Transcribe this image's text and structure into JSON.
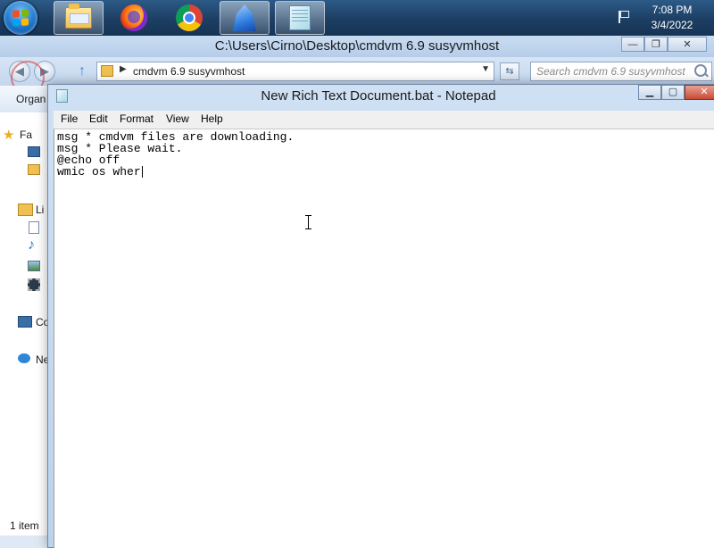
{
  "taskbar": {
    "apps": [
      {
        "name": "start",
        "icon": "windows-logo-icon"
      },
      {
        "name": "explorer",
        "icon": "folder-icon"
      },
      {
        "name": "firefox",
        "icon": "firefox-icon"
      },
      {
        "name": "chrome",
        "icon": "chrome-icon"
      },
      {
        "name": "app",
        "icon": "app-icon"
      },
      {
        "name": "notepad",
        "icon": "notepad-icon"
      }
    ],
    "clock": {
      "time": "7:08 PM",
      "date": "3/4/2022"
    }
  },
  "explorer": {
    "title": "C:\\Users\\Cirno\\Desktop\\cmdvm 6.9 susyvmhost",
    "address": "cmdvm 6.9 susyvmhost",
    "search_placeholder": "Search cmdvm 6.9 susyvmhost",
    "organize_label": "Organ",
    "sidebar": {
      "favorites": "Fa",
      "libraries": "Li",
      "computer": "Co",
      "network": "Ne"
    },
    "status": "1 item"
  },
  "notepad": {
    "title": "New Rich Text Document.bat - Notepad",
    "menu": [
      "File",
      "Edit",
      "Format",
      "View",
      "Help"
    ],
    "lines": [
      "msg * cmdvm files are downloading.",
      "msg * Please wait.",
      "@echo off",
      "wmic os wher"
    ]
  },
  "colors": {
    "taskbar": "#1d3e63",
    "titlebar": "#bcd3ec",
    "close_button": "#c84a33"
  }
}
